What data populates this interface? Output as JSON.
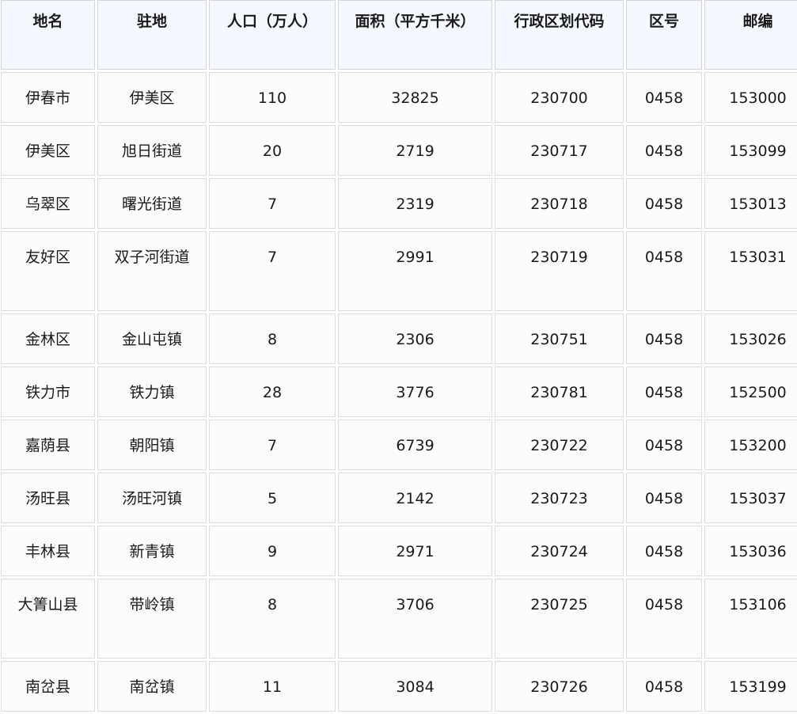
{
  "table": {
    "headers": [
      "地名",
      "驻地",
      "人口（万人）",
      "面积（平方千米）",
      "行政区划代码",
      "区号",
      "邮编"
    ],
    "rows": [
      [
        "伊春市",
        "伊美区",
        "110",
        "32825",
        "230700",
        "0458",
        "153000"
      ],
      [
        "伊美区",
        "旭日街道",
        "20",
        "2719",
        "230717",
        "0458",
        "153099"
      ],
      [
        "乌翠区",
        "曙光街道",
        "7",
        "2319",
        "230718",
        "0458",
        "153013"
      ],
      [
        "友好区",
        "双子河街道",
        "7",
        "2991",
        "230719",
        "0458",
        "153031"
      ],
      [
        "金林区",
        "金山屯镇",
        "8",
        "2306",
        "230751",
        "0458",
        "153026"
      ],
      [
        "铁力市",
        "铁力镇",
        "28",
        "3776",
        "230781",
        "0458",
        "152500"
      ],
      [
        "嘉荫县",
        "朝阳镇",
        "7",
        "6739",
        "230722",
        "0458",
        "153200"
      ],
      [
        "汤旺县",
        "汤旺河镇",
        "5",
        "2142",
        "230723",
        "0458",
        "153037"
      ],
      [
        "丰林县",
        "新青镇",
        "9",
        "2971",
        "230724",
        "0458",
        "153036"
      ],
      [
        "大箐山县",
        "带岭镇",
        "8",
        "3706",
        "230725",
        "0458",
        "153106"
      ],
      [
        "南岔县",
        "南岔镇",
        "11",
        "3084",
        "230726",
        "0458",
        "153199"
      ]
    ]
  }
}
